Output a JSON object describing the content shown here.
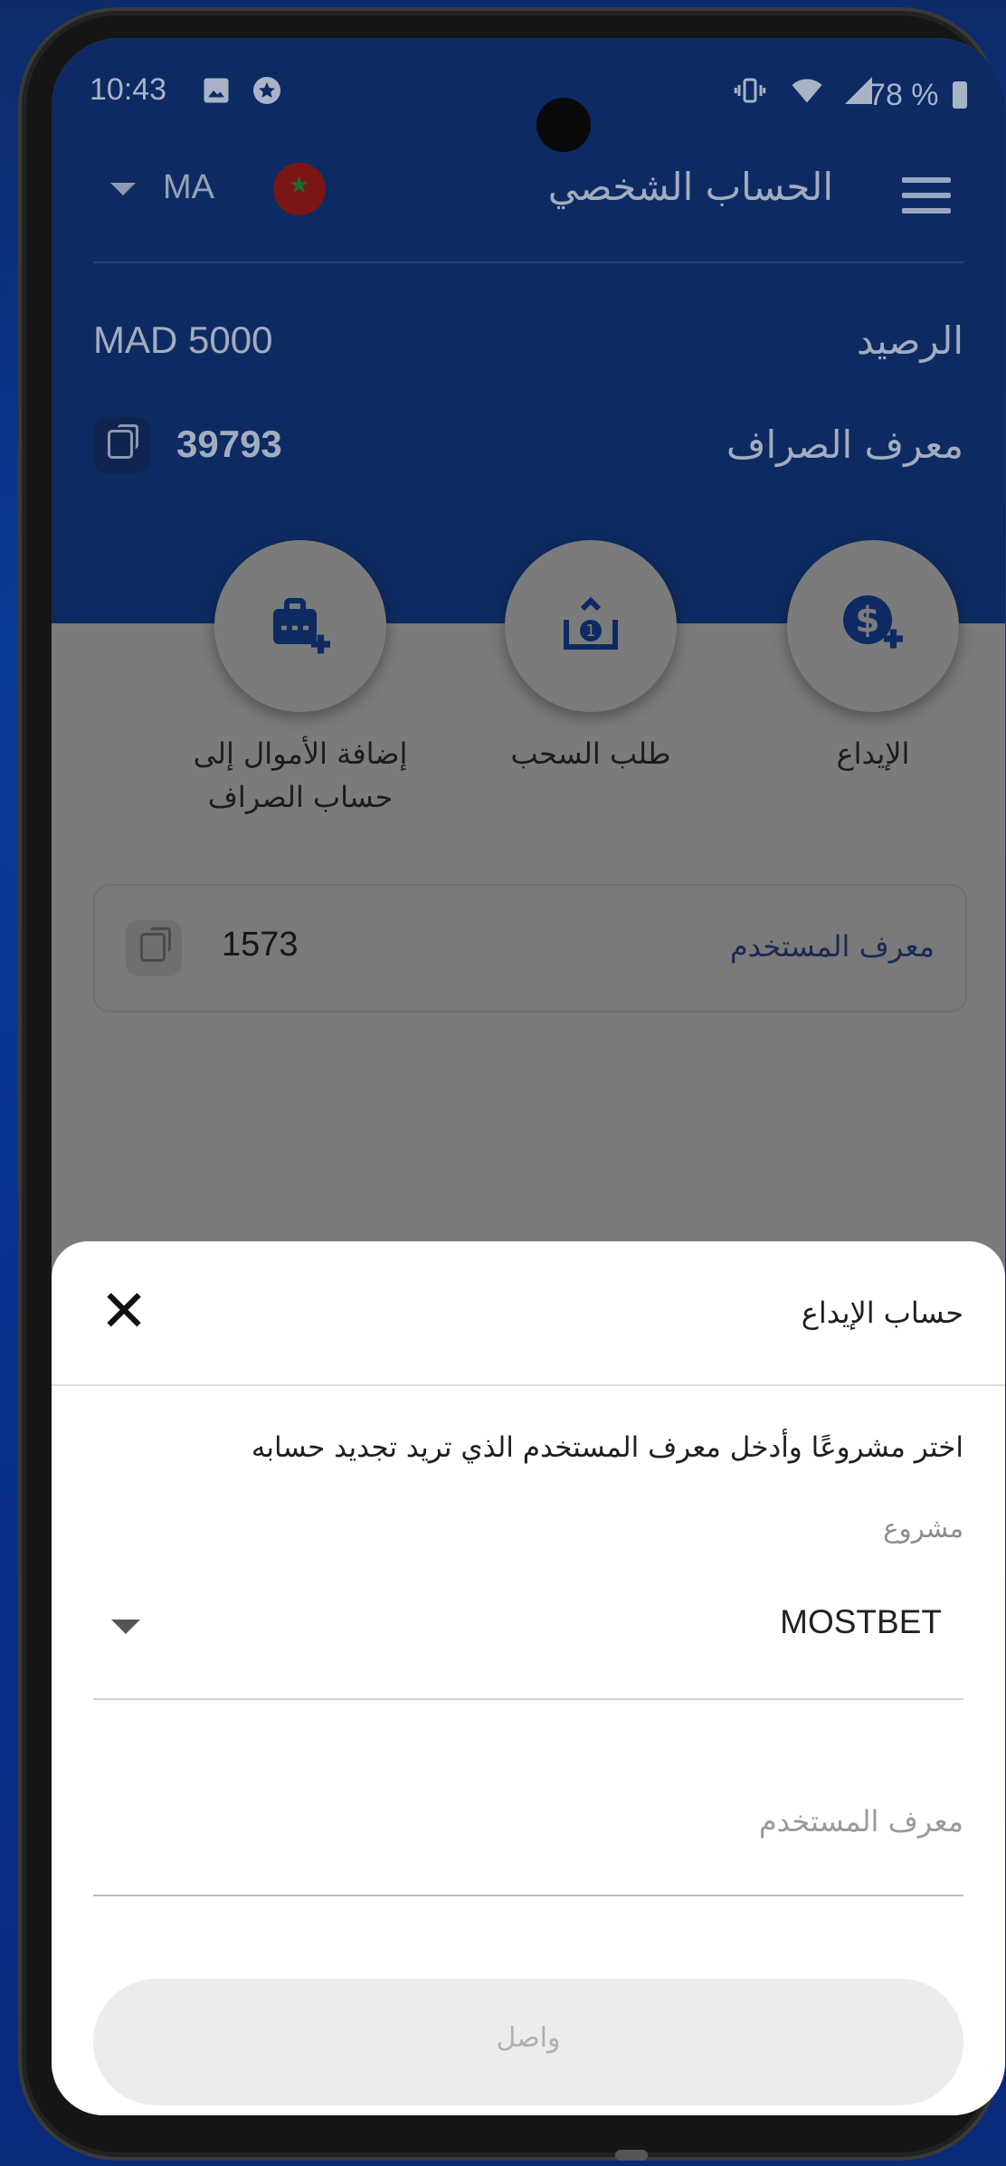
{
  "status_bar": {
    "time": "10:43",
    "battery": "78 %"
  },
  "header": {
    "menu_icon": "hamburger-menu-icon",
    "title": "الحساب الشخصي",
    "country_code": "MA",
    "flag_icon": "morocco-flag-icon"
  },
  "account": {
    "balance_label": "الرصيد",
    "balance_value": "MAD 5000",
    "exchanger_id_label": "معرف الصراف",
    "exchanger_id_value": "39793"
  },
  "actions": [
    {
      "label": "الإيداع",
      "icon": "dollar-plus-icon"
    },
    {
      "label": "طلب السحب",
      "icon": "withdraw-icon"
    },
    {
      "label_line1": "إضافة الأموال إلى",
      "label_line2": "حساب الصراف",
      "icon": "wallet-plus-icon"
    }
  ],
  "user_card": {
    "label": "معرف المستخدم",
    "value": "1573"
  },
  "sheet": {
    "title": "حساب الإيداع",
    "instruction": "اختر مشروعًا وأدخل معرف المستخدم الذي تريد تجديد حسابه",
    "project_label": "مشروع",
    "project_value": "MOSTBET",
    "user_id_placeholder": "معرف المستخدم",
    "submit_label": "واصل"
  },
  "colors": {
    "header_bg": "#0d2b62",
    "overlay_grey": "#7b7b7b",
    "sheet_bg": "#ffffff"
  }
}
